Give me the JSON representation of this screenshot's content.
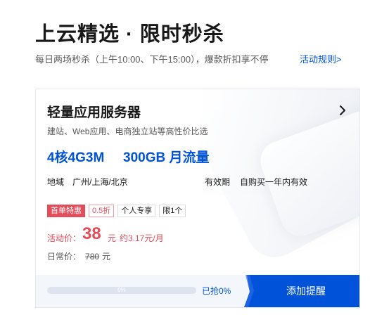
{
  "header": {
    "title": "上云精选 · 限时秒杀",
    "subtitle": "每日两场秒杀（上午10:00、下午15:00），爆款折扣享不停",
    "rules_link": "活动规则>"
  },
  "product": {
    "name": "轻量应用服务器",
    "desc": "建站、Web应用、电商独立站等高性价比选",
    "spec": "4核4G3M",
    "traffic": "300GB 月流量",
    "region_label": "地域",
    "region_value": "广州/上海/北京",
    "validity_label": "有效期",
    "validity_value": "自购买一年内有效",
    "tags": [
      "首单特惠",
      "0.5折",
      "个人专享",
      "限1个"
    ],
    "price_label": "活动价：",
    "price": "38",
    "price_unit": "元",
    "price_monthly": "约3.17元/月",
    "orig_label": "日常价：",
    "orig_price": "780",
    "orig_unit": "元",
    "progress": {
      "fraction": 0.0,
      "text": "0%",
      "grabbed_text": "已抢0%"
    },
    "remind_button": "添加提醒"
  },
  "colors": {
    "brand": "#0052d9",
    "price_red": "#e34d59",
    "card_border": "#e5e8ee",
    "progress_track": "#dde4f0"
  },
  "icons": {
    "detail": "chevron-right-icon"
  }
}
